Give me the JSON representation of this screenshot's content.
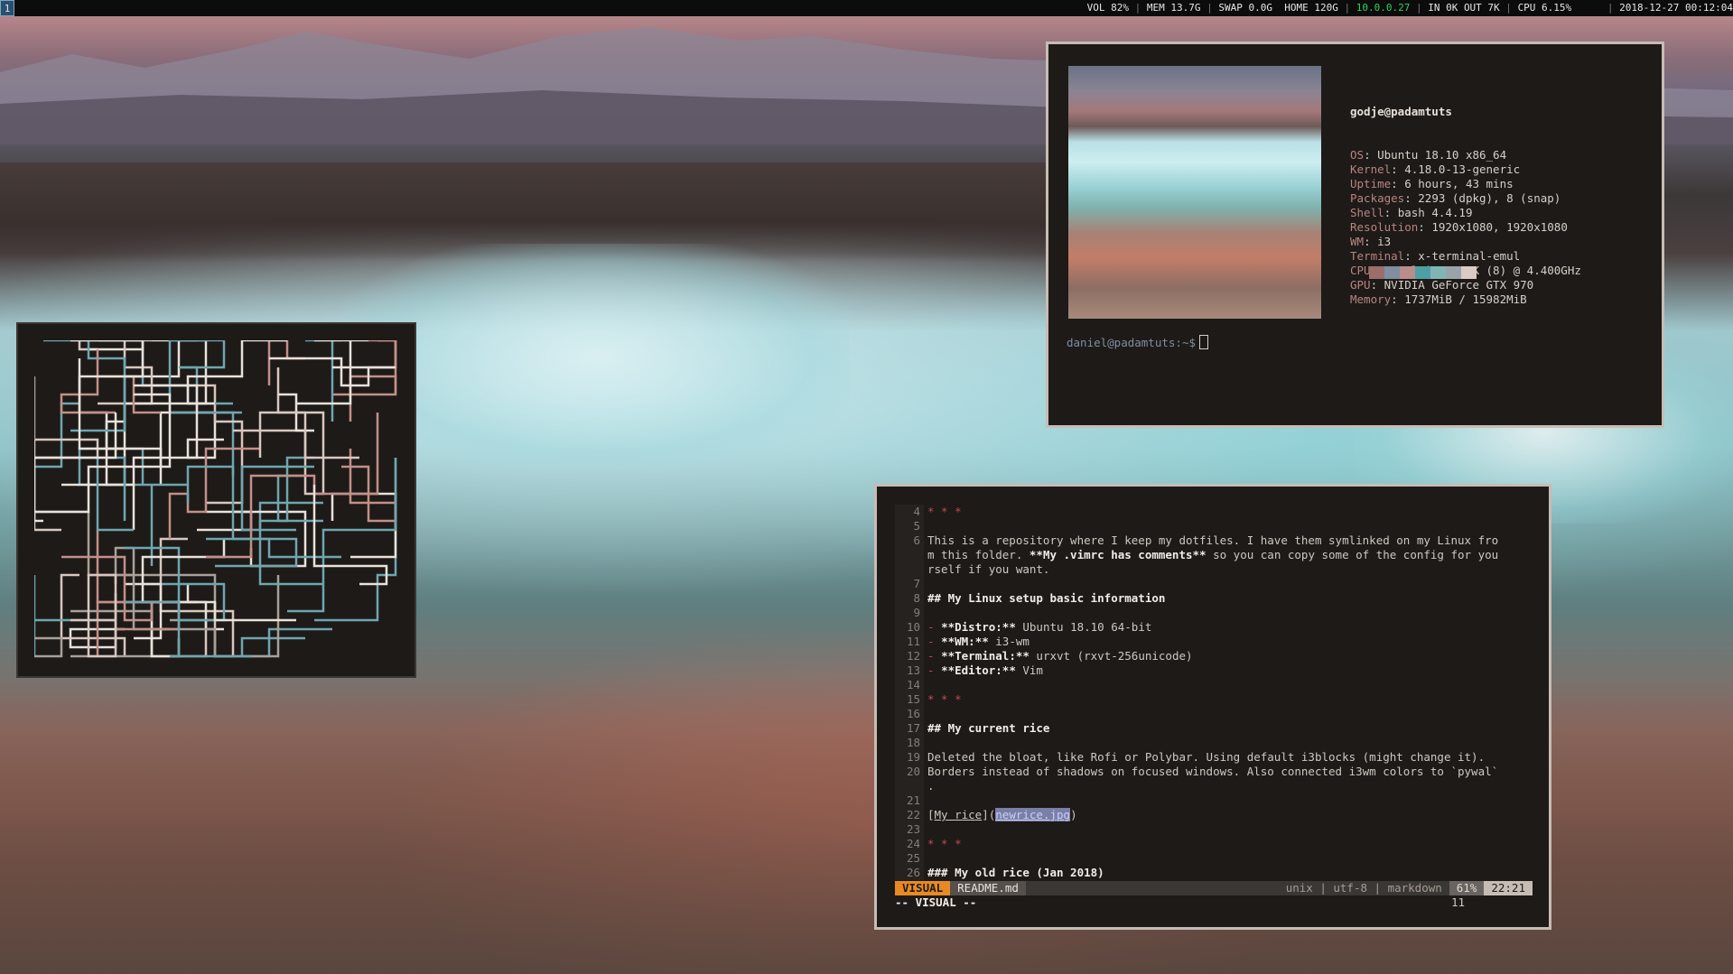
{
  "topbar": {
    "workspace": "1",
    "vol": "VOL 82%",
    "mem": "MEM 13.7G",
    "swap": "SWAP 0.0G",
    "home": "HOME 120G",
    "ip": "10.0.0.27",
    "net": "IN 0K OUT 7K",
    "cpu": "CPU 6.15%",
    "datetime": "2018-12-27 00:12:04"
  },
  "neofetch": {
    "user_host": "godje@padamtuts",
    "rows": [
      {
        "key": "OS",
        "value": "Ubuntu 18.10 x86_64"
      },
      {
        "key": "Kernel",
        "value": "4.18.0-13-generic"
      },
      {
        "key": "Uptime",
        "value": "6 hours, 43 mins"
      },
      {
        "key": "Packages",
        "value": "2293 (dpkg), 8 (snap)"
      },
      {
        "key": "Shell",
        "value": "bash 4.4.19"
      },
      {
        "key": "Resolution",
        "value": "1920x1080, 1920x1080"
      },
      {
        "key": "WM",
        "value": "i3"
      },
      {
        "key": "Terminal",
        "value": "x-terminal-emul"
      },
      {
        "key": "CPU",
        "value": "Intel i7-4790K (8) @ 4.400GHz"
      },
      {
        "key": "GPU",
        "value": "NVIDIA GeForce GTX 970"
      },
      {
        "key": "Memory",
        "value": "1737MiB / 15982MiB"
      }
    ],
    "palette": [
      "#9b6e6a",
      "#7f8ea0",
      "#b98d8a",
      "#4e9fa3",
      "#7fb6b4",
      "#9aa3a8",
      "#d9cac4"
    ],
    "prompt_user": "daniel@padamtuts",
    "prompt_suffix": ":~$"
  },
  "vim": {
    "lines": [
      {
        "n": "4",
        "t": "* * *",
        "s": "red"
      },
      {
        "n": "5",
        "t": "",
        "s": ""
      },
      {
        "n": "6",
        "t": "This is a repository where I keep my dotfiles. I have them symlinked on my Linux fro",
        "s": ""
      },
      {
        "n": "",
        "t": "m this folder. **My .vimrc has comments** so you can copy some of the config for you",
        "s": "boldpart"
      },
      {
        "n": "",
        "t": "rself if you want.",
        "s": ""
      },
      {
        "n": "7",
        "t": "",
        "s": ""
      },
      {
        "n": "8",
        "t": "## My Linux setup basic information",
        "s": "b"
      },
      {
        "n": "9",
        "t": "",
        "s": ""
      },
      {
        "n": "10",
        "t": "**Distro:** Ubuntu 18.10 64-bit",
        "s": "item"
      },
      {
        "n": "11",
        "t": "**WM:** i3-wm",
        "s": "item"
      },
      {
        "n": "12",
        "t": "**Terminal:** urxvt (rxvt-256unicode)",
        "s": "item"
      },
      {
        "n": "13",
        "t": "**Editor:** Vim",
        "s": "item"
      },
      {
        "n": "14",
        "t": "",
        "s": ""
      },
      {
        "n": "15",
        "t": "* * *",
        "s": "red"
      },
      {
        "n": "16",
        "t": "",
        "s": ""
      },
      {
        "n": "17",
        "t": "## My current rice",
        "s": "b"
      },
      {
        "n": "18",
        "t": "",
        "s": ""
      },
      {
        "n": "19",
        "t": "Deleted the bloat, like Rofi or Polybar. Using default i3blocks (might change it).",
        "s": ""
      },
      {
        "n": "20",
        "t": "Borders instead of shadows on focused windows. Also connected i3wm colors to `pywal`",
        "s": ""
      },
      {
        "n": "",
        "t": ".",
        "s": ""
      },
      {
        "n": "21",
        "t": "",
        "s": ""
      },
      {
        "n": "22",
        "t": "[My rice](newrice.jpg)",
        "s": "link"
      },
      {
        "n": "23",
        "t": "",
        "s": ""
      },
      {
        "n": "24",
        "t": "* * *",
        "s": "red"
      },
      {
        "n": "25",
        "t": "",
        "s": ""
      },
      {
        "n": "26",
        "t": "### My old rice (Jan 2018)",
        "s": "b"
      }
    ],
    "statusline": {
      "mode": "VISUAL",
      "file": "README.md",
      "info": "unix | utf-8 | markdown",
      "percent": "61%",
      "position": "22:21"
    },
    "cmdline": "-- VISUAL --",
    "selection_count": "11"
  }
}
